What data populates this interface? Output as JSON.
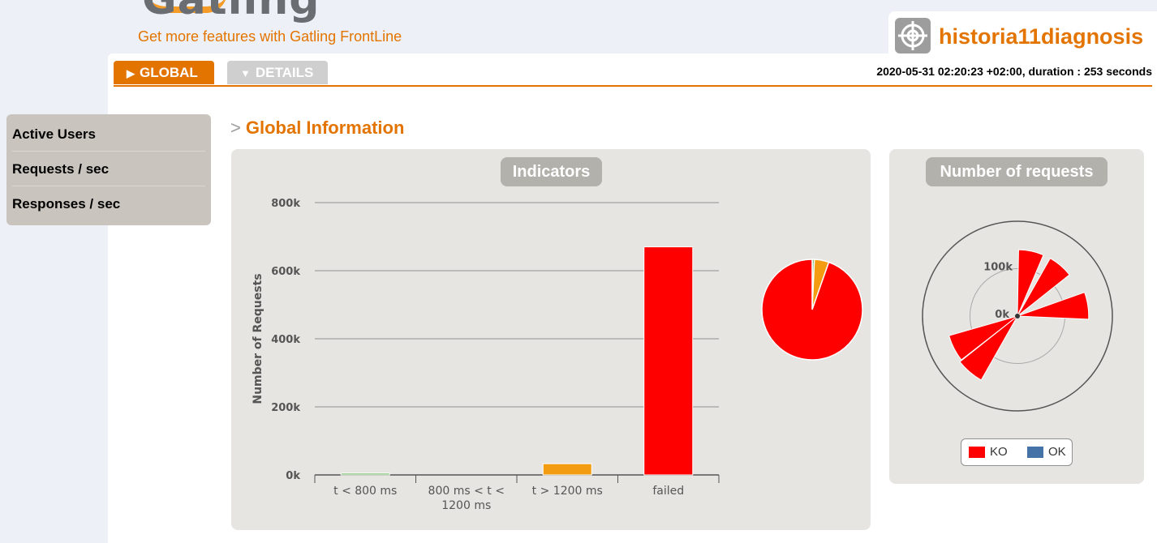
{
  "header": {
    "logo_text": "Gatling",
    "frontline_link": "Get more features with Gatling FrontLine",
    "simulation_name": "historia11diagnosis",
    "run_info": "2020-05-31 02:20:23 +02:00, duration : 253 seconds"
  },
  "tabs": [
    {
      "label": "GLOBAL",
      "icon": "triangle-right-icon"
    },
    {
      "label": "DETAILS",
      "icon": "triangle-down-icon"
    }
  ],
  "sidebar": {
    "items": [
      {
        "label": "Active Users"
      },
      {
        "label": "Requests / sec"
      },
      {
        "label": "Responses / sec"
      }
    ]
  },
  "main": {
    "title_prefix": ">",
    "title": "Global Information"
  },
  "indicators_panel": {
    "title": "Indicators"
  },
  "requests_panel": {
    "title": "Number of requests"
  },
  "colors": {
    "accent": "#e37400",
    "green": "#68b65c",
    "orange": "#f39c12",
    "red": "#ff0000",
    "ok_blue": "#4572a7"
  },
  "chart_data": [
    {
      "type": "bar",
      "title": "Indicators",
      "ylabel": "Number of Requests",
      "xlabel": "",
      "categories": [
        "t < 800 ms",
        "800 ms < t < 1200 ms",
        "t > 1200 ms",
        "failed"
      ],
      "values": [
        5000,
        0,
        33000,
        670000
      ],
      "colors": [
        "#68b65c",
        "#f1c40f",
        "#f39c12",
        "#ff0000"
      ],
      "ylim": [
        0,
        800000
      ],
      "y_ticks": [
        "0k",
        "200k",
        "400k",
        "600k",
        "800k"
      ],
      "grid": true
    },
    {
      "type": "pie",
      "values": [
        5000,
        0,
        33000,
        670000
      ],
      "colors": [
        "#68b65c",
        "#f1c40f",
        "#f39c12",
        "#ff0000"
      ]
    },
    {
      "type": "polar-area",
      "title": "Number of requests",
      "radial_ticks": [
        "0k",
        "100k"
      ],
      "radial_max": 200000,
      "series": [
        {
          "name": "KO",
          "color": "#ff0000",
          "wedges": [
            {
              "direction": "N",
              "value": 140000
            },
            {
              "direction": "NNE",
              "value": 140000
            },
            {
              "direction": "ENE",
              "value": 150000
            },
            {
              "direction": "SSW",
              "value": 155000
            },
            {
              "direction": "SW",
              "value": 150000
            }
          ]
        },
        {
          "name": "OK",
          "color": "#4572a7",
          "wedges": []
        }
      ],
      "legend": "bottom"
    }
  ]
}
